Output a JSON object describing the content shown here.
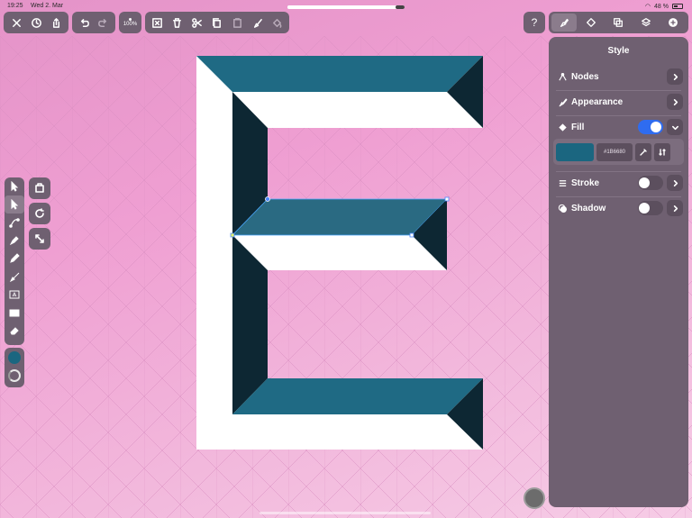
{
  "status_bar": {
    "time": "19:25",
    "date": "Wed 2. Mar",
    "battery": "48 %"
  },
  "document_progress": 0.93,
  "toolbar": {
    "close": "close-icon",
    "history": "clock-icon",
    "share": "share-icon",
    "undo": "undo-icon",
    "redo": "redo-icon",
    "zoom_label": "100%",
    "deselect": "deselect-icon",
    "delete": "trash-icon",
    "cut": "scissors-icon",
    "copy": "copy-icon",
    "paste": "paste-icon",
    "format_painter": "brush-icon",
    "fill_bucket": "bucket-icon"
  },
  "help_label": "?",
  "right_tabs": [
    "style-tab",
    "nodes-tab",
    "boolean-tab",
    "layers-tab",
    "add-tab"
  ],
  "panel": {
    "title": "Style",
    "rows": {
      "nodes": "Nodes",
      "appearance": "Appearance",
      "fill": "Fill",
      "stroke": "Stroke",
      "shadow": "Shadow"
    },
    "fill": {
      "enabled": true,
      "hex": "#1B6680"
    },
    "stroke": {
      "enabled": false
    },
    "shadow": {
      "enabled": false
    }
  },
  "colors": {
    "accent": "#2f6cf0",
    "fill_color": "#1b6680",
    "shape_dark": "#0d2733",
    "shape_mid": "#2a6a82",
    "panel_bg": "#6f6071"
  },
  "left_tools": [
    "select-icon",
    "direct-select-icon",
    "node-tool-icon",
    "pen-icon",
    "pencil-icon",
    "brush-icon",
    "text-icon",
    "rectangle-icon",
    "eraser-icon"
  ]
}
